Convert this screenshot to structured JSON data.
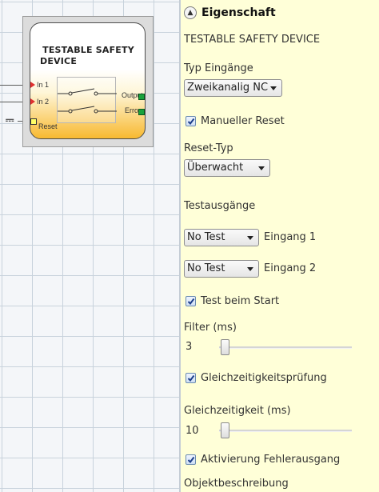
{
  "block": {
    "title_line1": "TESTABLE SAFETY",
    "title_line2": "DEVICE",
    "inputs": [
      "In 1",
      "In 2"
    ],
    "reset_label": "Reset",
    "outputs": [
      "Output",
      "Error"
    ]
  },
  "panel": {
    "header": "Eigenschaft",
    "device_name": "TESTABLE SAFETY DEVICE",
    "typ_eingaenge_label": "Typ Eingänge",
    "typ_eingaenge_value": "Zweikanalig NC",
    "manueller_reset_label": "Manueller Reset",
    "manueller_reset_checked": true,
    "reset_typ_label": "Reset-Typ",
    "reset_typ_value": "Überwacht",
    "testausgaenge_label": "Testausgänge",
    "test1_value": "No Test",
    "test1_label": "Eingang 1",
    "test2_value": "No Test",
    "test2_label": "Eingang 2",
    "test_start_label": "Test beim Start",
    "test_start_checked": true,
    "filter_label": "Filter (ms)",
    "filter_value": "3",
    "gleichzeitigkeitspruefung_label": "Gleichzeitigkeitsprüfung",
    "gleichzeitigkeitspruefung_checked": true,
    "gleichzeitigkeit_label": "Gleichzeitigkeit (ms)",
    "gleichzeitigkeit_value": "10",
    "aktivierung_label": "Aktivierung Fehlerausgang",
    "aktivierung_checked": true,
    "objektbeschreibung_label": "Objektbeschreibung"
  },
  "colors": {
    "panel_bg": "#ffffd8",
    "block_gradient_bottom": "#f8b930",
    "input_pin": "#e03030",
    "output_pin": "#1aa33c",
    "reset_pin": "#ffff66"
  },
  "icons": {
    "collapse": "chevron-up-circle-icon",
    "pulse": "pulse-signal-icon"
  }
}
